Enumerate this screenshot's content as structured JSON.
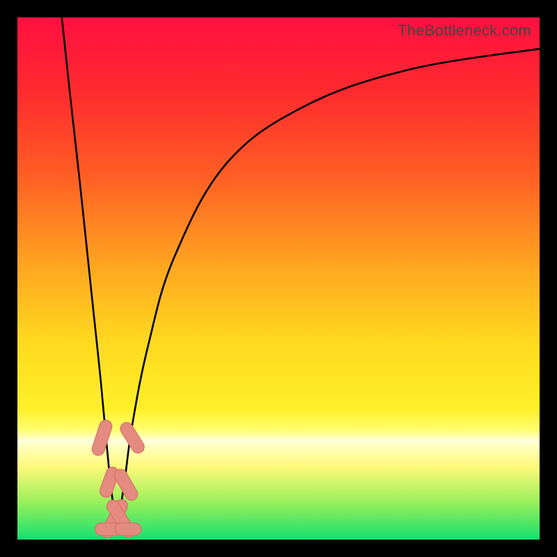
{
  "watermark": "TheBottleneck.com",
  "colors": {
    "frame": "#000000",
    "gradient_stops": [
      {
        "pct": 0,
        "hex": "#ff1040"
      },
      {
        "pct": 14,
        "hex": "#ff2a2e"
      },
      {
        "pct": 30,
        "hex": "#ff5d24"
      },
      {
        "pct": 48,
        "hex": "#ffa71f"
      },
      {
        "pct": 62,
        "hex": "#ffd91f"
      },
      {
        "pct": 75,
        "hex": "#fff028"
      },
      {
        "pct": 79,
        "hex": "#ffff70"
      },
      {
        "pct": 80.5,
        "hex": "#ffffc0"
      },
      {
        "pct": 81.2,
        "hex": "#ffffe0"
      },
      {
        "pct": 82,
        "hex": "#ffffc0"
      },
      {
        "pct": 86,
        "hex": "#fff97a"
      },
      {
        "pct": 93,
        "hex": "#96ef5a"
      },
      {
        "pct": 100,
        "hex": "#14e070"
      }
    ],
    "curve": "#000000",
    "marker_fill": "#e48a80",
    "marker_stroke": "#d77066"
  },
  "chart_data": {
    "type": "line",
    "title": "",
    "xlabel": "",
    "ylabel": "",
    "xlim": [
      0,
      100
    ],
    "ylim": [
      0,
      100
    ],
    "grid": false,
    "legend": false,
    "note": "x is horizontal percent across the plot (0=left,100=right); y is bottleneck percent (0=bottom/green, 100=top/red). Curves are V-shaped with minimum near x≈19.",
    "series": [
      {
        "name": "left-branch",
        "x": [
          8.5,
          10,
          12,
          14,
          16,
          17.5,
          19
        ],
        "y": [
          100,
          86,
          68,
          49,
          30,
          14,
          1
        ]
      },
      {
        "name": "right-branch",
        "x": [
          19,
          20.5,
          22,
          25,
          30,
          40,
          55,
          75,
          100
        ],
        "y": [
          1,
          11,
          22,
          37,
          54,
          72,
          83,
          90,
          94
        ]
      }
    ],
    "markers": {
      "name": "near-optimum-markers",
      "shape": "capsule",
      "points": [
        {
          "x": 16.2,
          "y": 19.5,
          "len": 7,
          "angle": -72
        },
        {
          "x": 17.6,
          "y": 11.0,
          "len": 6,
          "angle": -70
        },
        {
          "x": 18.6,
          "y": 4.0,
          "len": 8,
          "angle": -62
        },
        {
          "x": 19.8,
          "y": 4.0,
          "len": 8,
          "angle": 58
        },
        {
          "x": 20.8,
          "y": 10.5,
          "len": 6.5,
          "angle": 60
        },
        {
          "x": 22.0,
          "y": 19.5,
          "len": 6.5,
          "angle": 58
        },
        {
          "x": 17.4,
          "y": 2.0,
          "len": 5,
          "angle": 0
        },
        {
          "x": 21.2,
          "y": 2.0,
          "len": 5,
          "angle": 0
        }
      ]
    }
  }
}
